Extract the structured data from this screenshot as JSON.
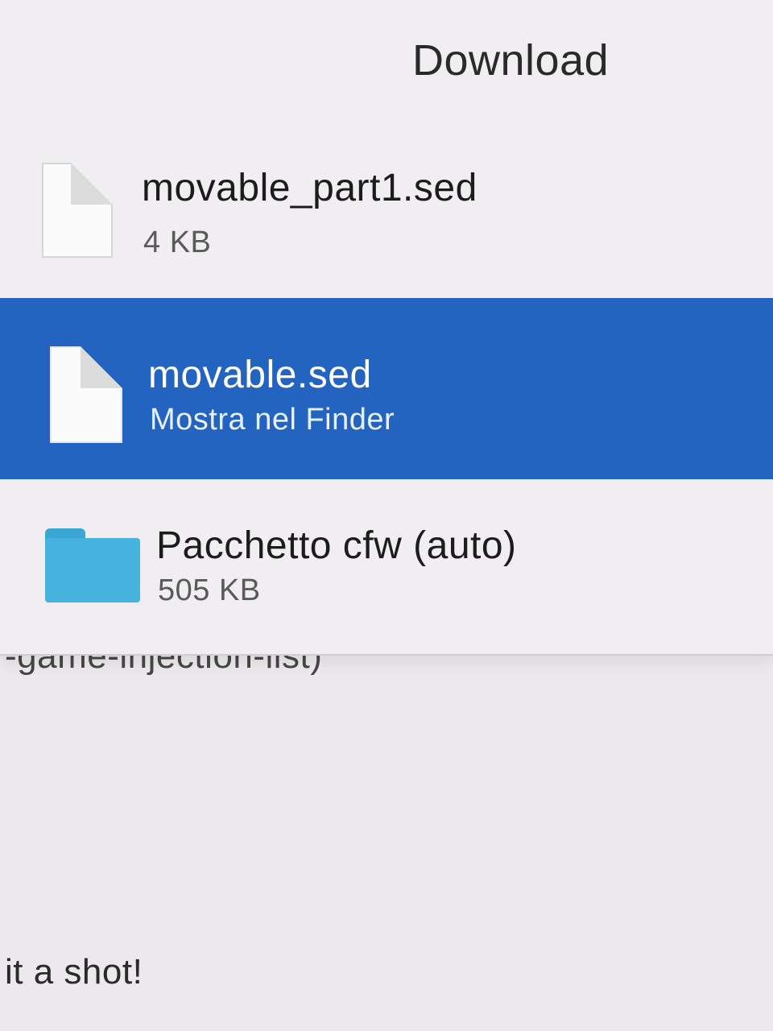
{
  "popover": {
    "title": "Download",
    "items": [
      {
        "name": "movable_part1.sed",
        "detail": "4 KB",
        "icon": "document-icon",
        "selected": false
      },
      {
        "name": "movable.sed",
        "detail": "Mostra nel Finder",
        "icon": "document-icon",
        "selected": true
      },
      {
        "name": "Pacchetto cfw (auto)",
        "detail": "505 KB",
        "icon": "folder-icon",
        "selected": false
      }
    ]
  },
  "background_page": {
    "line1": "-game-injection-list)",
    "line2": "it a shot!"
  },
  "colors": {
    "selection": "#2264bf",
    "folder": "#45b3dd"
  }
}
